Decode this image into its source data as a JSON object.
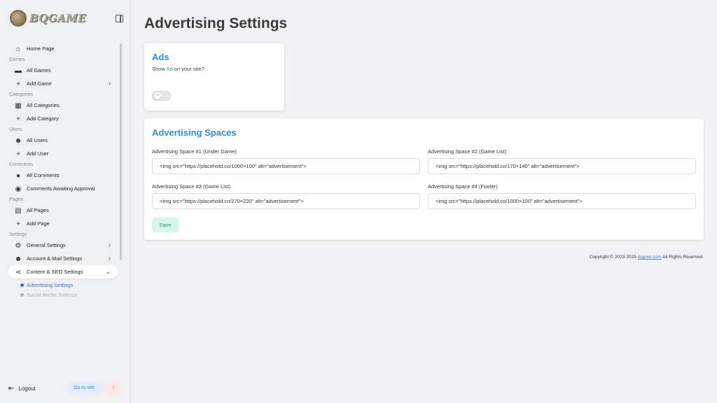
{
  "brand": {
    "name": "BQGAME"
  },
  "sidebar": {
    "home": "Home Page",
    "groups": {
      "games": "Games",
      "categories": "Categories",
      "users": "Users",
      "comments": "Comments",
      "pages": "Pages",
      "settings": "Settings"
    },
    "items": {
      "all_games": "All Games",
      "add_game": "Add Game",
      "all_categories": "All Categories",
      "add_category": "Add Category",
      "all_users": "All Users",
      "add_user": "Add User",
      "all_comments": "All Comments",
      "comments_awaiting": "Comments Awaiting Approval",
      "all_pages": "All Pages",
      "add_page": "Add Page",
      "general_settings": "General Settings",
      "account_mail_settings": "Account & Mail Settings",
      "content_seo_settings": "Content & SEO Settings",
      "advertising_settings": "Advertising Settings",
      "social_media_settings": "Social Media Settings"
    },
    "logout": "Logout",
    "go_to_site": "Go to site",
    "alert": "!"
  },
  "main": {
    "title": "Advertising Settings",
    "ads_card": {
      "title": "Ads",
      "desc_prefix": "Show",
      "desc_highlight": "Ad",
      "desc_suffix": "on your site?",
      "enabled": false
    },
    "spaces_card": {
      "title": "Advertising Spaces",
      "fields": [
        {
          "label": "Advertising Space #1 (Under Game)",
          "value": "<img src=\"https://placehold.co/1000×100\" alt=\"advertisement\">"
        },
        {
          "label": "Advertising Space #2 (Game List)",
          "value": "<img src=\"https://placehold.co/170×140\" alt=\"advertisement\">"
        },
        {
          "label": "Advertising Space #3 (Game List)",
          "value": "<img src=\"https://placehold.co/270×220\" alt=\"advertisement\">"
        },
        {
          "label": "Advertising Space #4 (Footer)",
          "value": "<img src=\"https://placehold.co/1000×100\" alt=\"advertisement\">"
        }
      ],
      "save_label": "Save"
    }
  },
  "footer": {
    "prefix": "Copyright © 2023-2025",
    "link": "bqgnet.com",
    "suffix": "All Rights Reserved."
  },
  "colors": {
    "accent": "#2f8be0",
    "active_sub": "#3b6fd8",
    "save_bg": "#d6f5ea",
    "save_text": "#1f9d64"
  }
}
